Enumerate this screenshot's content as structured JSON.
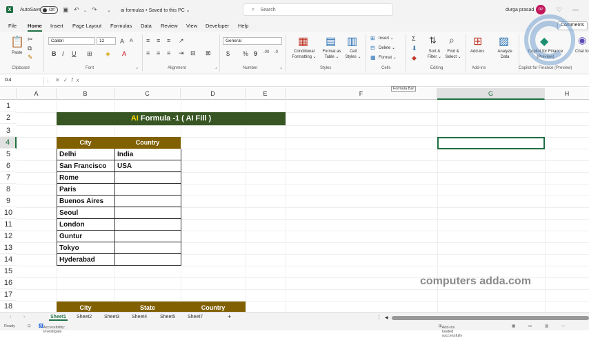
{
  "titlebar": {
    "autosave_label": "AutoSave",
    "toggle_state": "Off",
    "doc_title": "ai formulas • Saved to this PC ⌄",
    "search_placeholder": "Search",
    "user_name": "durga prasad",
    "user_initials": "DP"
  },
  "menu": {
    "items": [
      "File",
      "Home",
      "Insert",
      "Page Layout",
      "Formulas",
      "Data",
      "Review",
      "View",
      "Developer",
      "Help"
    ],
    "active": "Home",
    "comments": "Comments"
  },
  "ribbon": {
    "clipboard": {
      "paste": "Paste",
      "label": "Clipboard"
    },
    "font": {
      "name": "Calibri",
      "size": "12",
      "label": "Font"
    },
    "alignment": {
      "label": "Alignment"
    },
    "number": {
      "format": "General",
      "label": "Number"
    },
    "styles": {
      "conditional": "Conditional Formatting ⌄",
      "format_table": "Format as Table ⌄",
      "cell_styles": "Cell Styles ⌄",
      "label": "Styles"
    },
    "cells": {
      "insert": "Insert ⌄",
      "delete": "Delete ⌄",
      "format": "Format ⌄",
      "label": "Cells"
    },
    "editing": {
      "sort": "Sort & Filter ⌄",
      "find": "Find & Select ⌄",
      "label": "Editing"
    },
    "addins": {
      "addins": "Add-ins",
      "label": "Add-ins",
      "analyze": "Analyze Data"
    },
    "copilot": {
      "name": "Copilot for Finance (Preview)",
      "label": "Copilot for Finance (Preview)",
      "chat": "Chat for E"
    }
  },
  "formula_bar": {
    "name_box": "G4",
    "fx": "fx",
    "tooltip": "Formula Bar"
  },
  "columns": [
    "A",
    "B",
    "C",
    "D",
    "E",
    "F",
    "G",
    "H"
  ],
  "rows": [
    "1",
    "2",
    "3",
    "4",
    "5",
    "6",
    "7",
    "8",
    "9",
    "10",
    "11",
    "12",
    "13",
    "14",
    "15",
    "16",
    "17",
    "18"
  ],
  "sheet": {
    "banner_ai": "AI",
    "banner_rest": " Formula -1 ( AI Fill )",
    "table1": {
      "headers": [
        "City",
        "Country"
      ],
      "cities": [
        "Delhi",
        "San Francisco",
        "Rome",
        "Paris",
        "Buenos Aires",
        "Seoul",
        "London",
        "Guntur",
        "Tokyo",
        "Hyderabad"
      ],
      "countries": [
        "India",
        "USA",
        "",
        "",
        "",
        "",
        "",
        "",
        "",
        ""
      ]
    },
    "table2": {
      "headers": [
        "City",
        "State",
        "Country"
      ]
    }
  },
  "watermark": "computers adda.com",
  "tabs": {
    "sheets": [
      "Sheet1",
      "Sheet2",
      "Sheet3",
      "Sheet4",
      "Sheet5",
      "Sheet7"
    ],
    "active": "Sheet1",
    "add": "+"
  },
  "status": {
    "ready": "Ready",
    "accessibility": "Accessibility: Investigate",
    "addins": "Add-ins loaded successfully"
  }
}
